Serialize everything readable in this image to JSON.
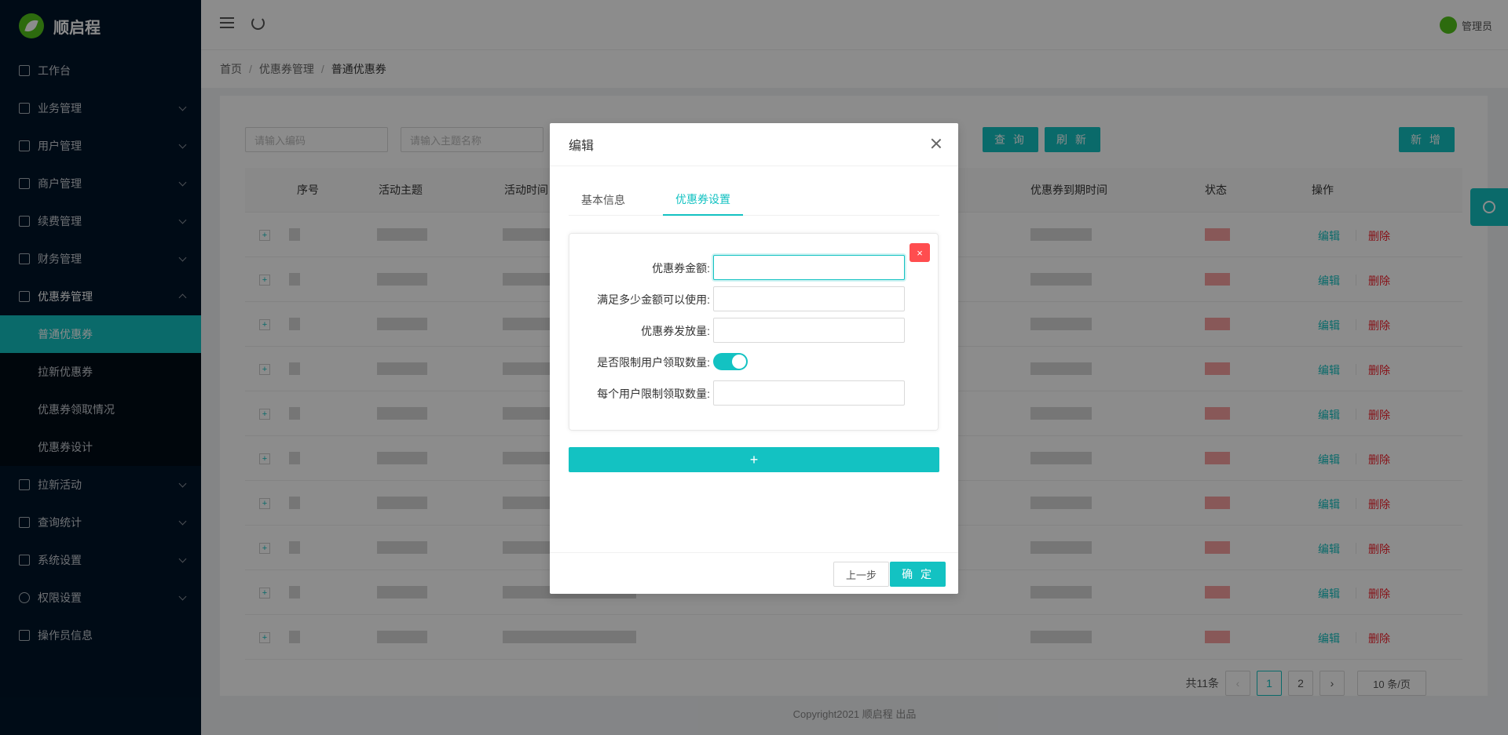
{
  "app": {
    "title": "顺启程"
  },
  "sidebar": {
    "items": [
      {
        "label": "工作台"
      },
      {
        "label": "业务管理"
      },
      {
        "label": "用户管理"
      },
      {
        "label": "商户管理"
      },
      {
        "label": "续费管理"
      },
      {
        "label": "财务管理"
      },
      {
        "label": "优惠券管理"
      },
      {
        "label": "拉新活动"
      },
      {
        "label": "查询统计"
      },
      {
        "label": "系统设置"
      },
      {
        "label": "权限设置"
      },
      {
        "label": "操作员信息"
      }
    ],
    "submenu": [
      {
        "label": "普通优惠券"
      },
      {
        "label": "拉新优惠券"
      },
      {
        "label": "优惠券领取情况"
      },
      {
        "label": "优惠券设计"
      }
    ]
  },
  "header": {
    "user": "管理员"
  },
  "breadcrumb": [
    "首页",
    "优惠券管理",
    "普通优惠券"
  ],
  "search": {
    "code_placeholder": "请输入编码",
    "topic_placeholder": "请输入主题名称",
    "query_label": "查 询",
    "refresh_label": "刷 新",
    "add_label": "新 增"
  },
  "table": {
    "columns": [
      "序号",
      "活动主题",
      "活动时间",
      "优惠券到期时间",
      "状态",
      "操作"
    ],
    "edit_label": "编辑",
    "delete_label": "删除",
    "row_count": 10
  },
  "pagination": {
    "total": "共11条",
    "pages": [
      "1",
      "2"
    ],
    "current": "1",
    "size": "10 条/页"
  },
  "footer": {
    "copyright": "Copyright2021 顺启程 出品"
  },
  "modal": {
    "title": "编辑",
    "tabs": [
      "基本信息",
      "优惠券设置"
    ],
    "active_tab": "优惠券设置",
    "fields": {
      "amount_label": "优惠券金额:",
      "min_amount_label": "满足多少金额可以使用:",
      "quantity_label": "优惠券发放量:",
      "limit_toggle_label": "是否限制用户领取数量:",
      "per_user_limit_label": "每个用户限制领取数量:"
    },
    "limit_toggle_on": true,
    "delete_glyph": "×",
    "add_glyph": "+",
    "prev_label": "上一步",
    "confirm_label": "确 定"
  },
  "colors": {
    "accent": "#13c2c2",
    "sidebar": "#001529",
    "danger": "#ff4d4f"
  }
}
